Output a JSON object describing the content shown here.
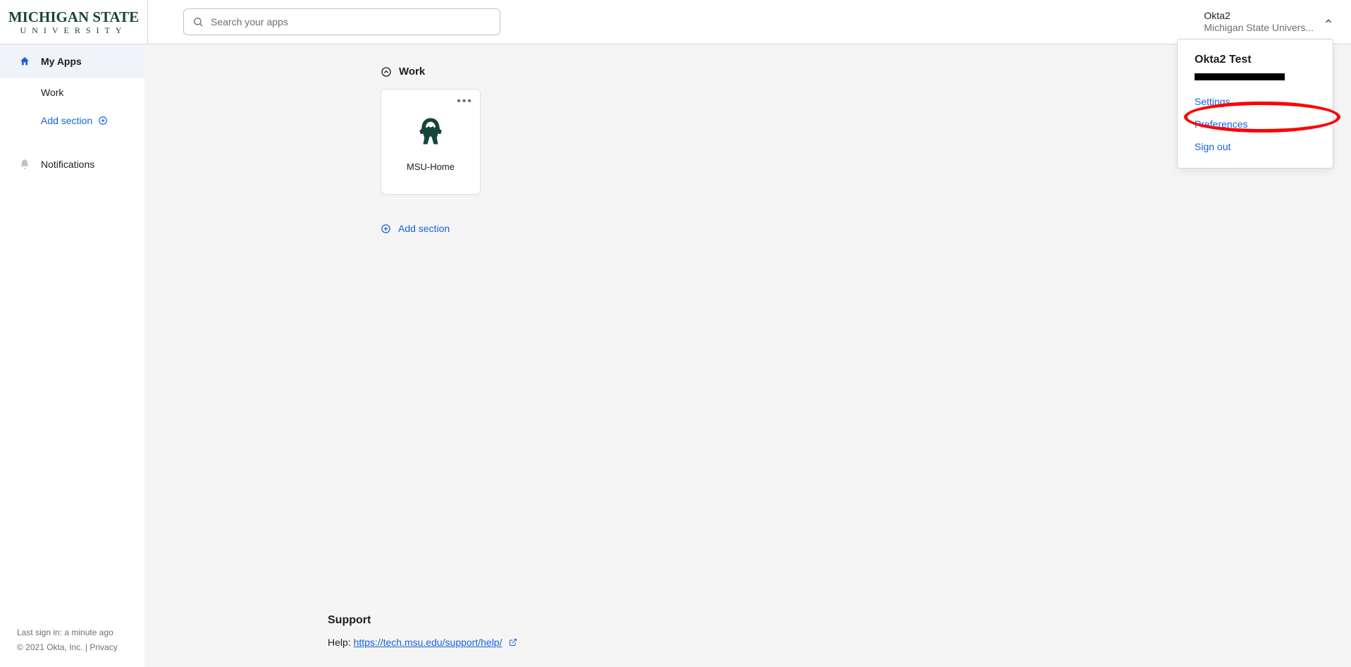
{
  "header": {
    "logo_line1": "MICHIGAN STATE",
    "logo_line2": "UNIVERSITY",
    "search_placeholder": "Search your apps",
    "user_line1": "Okta2",
    "user_line2": "Michigan State Univers..."
  },
  "sidebar": {
    "items": {
      "my_apps": "My Apps",
      "work": "Work",
      "add_section": "Add section",
      "notifications": "Notifications"
    },
    "footer": {
      "last_signin": "Last sign in: a minute ago",
      "copyright": "© 2021 Okta, Inc.",
      "sep": " | ",
      "privacy": "Privacy"
    }
  },
  "main": {
    "section_title": "Work",
    "apps": [
      {
        "label": "MSU-Home"
      }
    ],
    "add_section": "Add section"
  },
  "support": {
    "heading": "Support",
    "label": "Help: ",
    "link": "https://tech.msu.edu/support/help/"
  },
  "dropdown": {
    "title": "Okta2 Test",
    "links": {
      "settings": "Settings",
      "preferences": "Preferences",
      "signout": "Sign out"
    }
  }
}
